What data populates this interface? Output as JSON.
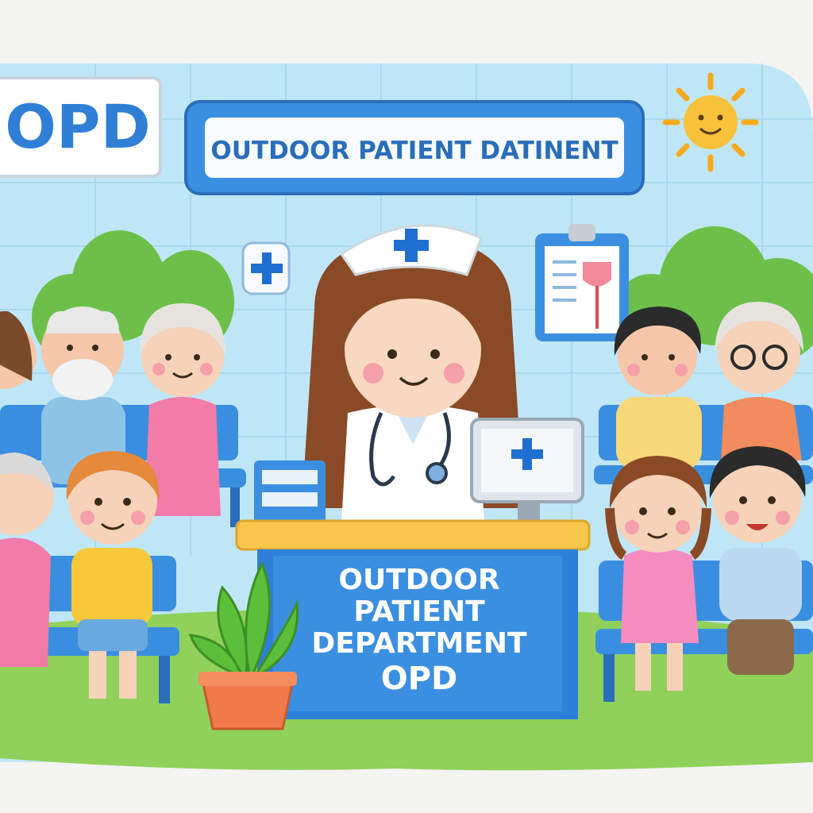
{
  "signs": {
    "opd_sign": "OPD",
    "banner": "OUTDOOR PATIENT DATINENT"
  },
  "desk": {
    "line1": "OUTDOOR",
    "line2": "PATIENT",
    "line3": "DEPARTMENT",
    "line4": "OPD"
  },
  "colors": {
    "wall": "#bfe6f6",
    "grid": "#a9d8ee",
    "brand_blue": "#2f7fd6",
    "banner_blue": "#3b8fe0",
    "desk_blue": "#2d7fd8",
    "desk_top": "#f7c64a",
    "floor": "#8fd15a",
    "bush": "#6cc04a",
    "chair": "#3a8ee0",
    "sun": "#f7c23a",
    "cross": "#1f6fd0"
  },
  "icons": [
    "sun-icon",
    "medical-cross-icon",
    "clipboard-icon",
    "computer-monitor-icon",
    "stethoscope-icon",
    "potted-plant-icon",
    "file-folders-icon"
  ]
}
